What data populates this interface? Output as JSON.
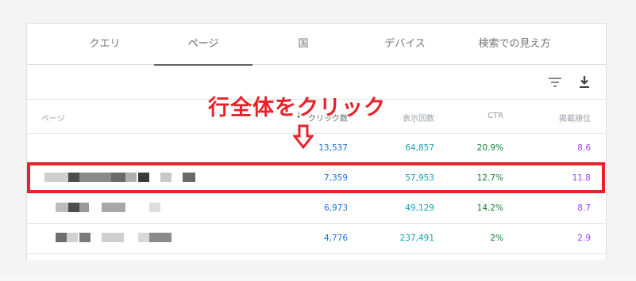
{
  "tabs": [
    {
      "label": "クエリ",
      "active": false
    },
    {
      "label": "ページ",
      "active": true
    },
    {
      "label": "国",
      "active": false
    },
    {
      "label": "デバイス",
      "active": false
    },
    {
      "label": "検索での見え方",
      "active": false
    }
  ],
  "toolbar": {
    "filter_icon": "filter-icon",
    "download_icon": "download-icon"
  },
  "columns": {
    "page": "ページ",
    "clicks": "クリック数",
    "impressions": "表示回数",
    "ctr": "CTR",
    "position": "掲載順位",
    "sort_icon": "arrow-down-icon"
  },
  "rows": [
    {
      "clicks": "13,537",
      "impressions": "64,857",
      "ctr": "20.9%",
      "position": "8.6"
    },
    {
      "clicks": "7,359",
      "impressions": "57,953",
      "ctr": "12.7%",
      "position": "11.8"
    },
    {
      "clicks": "6,973",
      "impressions": "49,129",
      "ctr": "14.2%",
      "position": "8.7"
    },
    {
      "clicks": "4,776",
      "impressions": "237,491",
      "ctr": "2%",
      "position": "2.9"
    }
  ],
  "annotation": {
    "text": "行全体をクリック",
    "color": "#e8212a"
  },
  "colors": {
    "clicks": "#1a73e8",
    "impressions": "#12a4af",
    "ctr": "#188038",
    "position": "#a142f4"
  }
}
